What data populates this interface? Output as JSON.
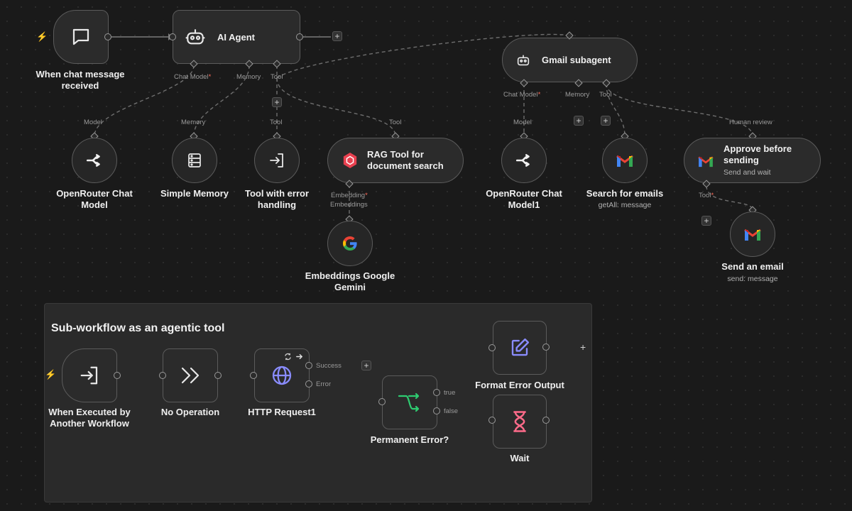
{
  "nodes": {
    "chat_trigger": {
      "title": "When chat message",
      "title2": "received"
    },
    "ai_agent": {
      "title": "AI Agent",
      "ports": {
        "chat_model": "Chat Model",
        "memory": "Memory",
        "tool": "Tool"
      }
    },
    "gmail_subagent": {
      "title": "Gmail subagent",
      "ports": {
        "chat_model": "Chat Model",
        "memory": "Memory",
        "tool": "Tool"
      }
    },
    "openrouter": {
      "title": "OpenRouter Chat",
      "title2": "Model",
      "port": "Model"
    },
    "simple_memory": {
      "title": "Simple Memory",
      "port": "Memory"
    },
    "tool_error": {
      "title": "Tool with error",
      "title2": "handling",
      "port": "Tool"
    },
    "rag_tool": {
      "title": "RAG Tool for",
      "title2": "document search",
      "port": "Tool",
      "ports": {
        "embedding": "Embedding"
      }
    },
    "embeddings": {
      "title": "Embeddings Google",
      "title2": "Gemini",
      "port": "Embeddings"
    },
    "openrouter1": {
      "title": "OpenRouter Chat",
      "title2": "Model1",
      "port": "Model"
    },
    "search_emails": {
      "title": "Search for emails",
      "subtitle": "getAll: message"
    },
    "approve": {
      "title": "Approve before",
      "title2": "sending",
      "subtitle": "Send and wait",
      "port": "Human review",
      "ports": {
        "tool": "Tool"
      }
    },
    "send_email": {
      "title": "Send an email",
      "subtitle": "send: message"
    },
    "exec_trigger": {
      "title": "When Executed by",
      "title2": "Another Workflow"
    },
    "no_op": {
      "title": "No Operation"
    },
    "http": {
      "title": "HTTP Request1",
      "ports": {
        "success": "Success",
        "error": "Error"
      }
    },
    "perm_error": {
      "title": "Permanent Error?",
      "ports": {
        "true": "true",
        "false": "false"
      }
    },
    "format_error": {
      "title": "Format Error Output"
    },
    "wait": {
      "title": "Wait"
    }
  },
  "sticky": {
    "title": "Sub-workflow as an agentic tool"
  },
  "symbols": {
    "required": "*",
    "plus": "+",
    "bolt": "⚡"
  },
  "colors": {
    "trigger": "#ff6d5a",
    "gmail_red": "#ea4335",
    "rag_red": "#e8404f",
    "switch_green": "#2ecc71",
    "edit_purple": "#8a8cff",
    "wait_pink": "#ff6b8a",
    "globe_purple": "#8a8cff"
  }
}
